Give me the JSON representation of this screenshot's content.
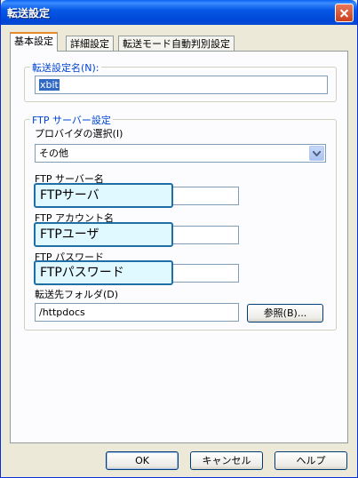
{
  "window": {
    "title": "転送設定"
  },
  "tabs": [
    {
      "label": "基本設定"
    },
    {
      "label": "詳細設定"
    },
    {
      "label": "転送モード自動判別設定"
    }
  ],
  "transfer_name": {
    "legend": "転送設定名(N):",
    "value": "xbit"
  },
  "ftp_settings": {
    "legend": "FTP サーバー設定",
    "provider_label": "プロバイダの選択(I)",
    "provider_value": "その他",
    "server_label": "FTP サーバー名",
    "server_hint": "FTPサーバ",
    "account_label": "FTP アカウント名",
    "account_hint": "FTPユーザ",
    "password_label": "FTP パスワード",
    "password_hint": "FTPパスワード",
    "folder_label": "転送先フォルダ(D)",
    "folder_value": "/httpdocs",
    "browse_label": "参照(B)..."
  },
  "footer": {
    "ok_label": "OK",
    "cancel_label": "キャンセル",
    "help_label": "ヘルプ"
  }
}
